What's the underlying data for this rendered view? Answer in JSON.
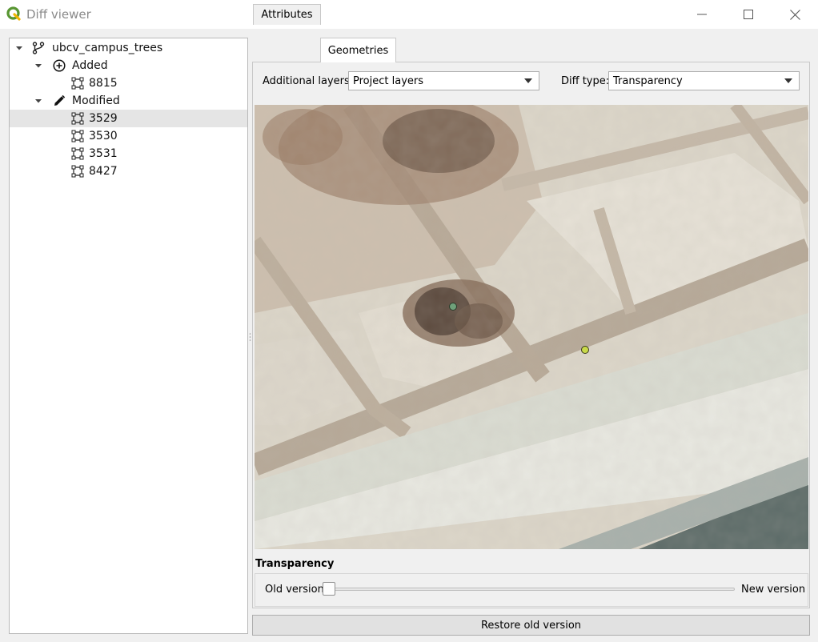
{
  "window": {
    "title": "Diff viewer",
    "app_icon": "qgis-logo-icon",
    "controls": [
      "minimize-icon",
      "maximize-icon",
      "close-icon"
    ]
  },
  "tree": {
    "root": {
      "label": "ubcv_campus_trees",
      "icon": "branch-icon",
      "expanded": true
    },
    "groups": [
      {
        "label": "Added",
        "icon": "plus-circle-icon",
        "expanded": true,
        "items": [
          "8815"
        ]
      },
      {
        "label": "Modified",
        "icon": "pencil-icon",
        "expanded": true,
        "items": [
          "3529",
          "3530",
          "3531",
          "8427"
        ]
      }
    ],
    "selected_item": "3529"
  },
  "tabs": [
    {
      "label": "Attributes",
      "active": false
    },
    {
      "label": "Geometries",
      "active": true
    }
  ],
  "controls": {
    "additional_layers_label": "Additional layers:",
    "additional_layers_value": "Project layers",
    "diff_type_label": "Diff type:",
    "diff_type_value": "Transparency"
  },
  "map": {
    "description_points": [
      {
        "name": "old-point",
        "color": "#6fa07a"
      },
      {
        "name": "new-point",
        "color": "#c8d94a"
      }
    ]
  },
  "transparency": {
    "section_title": "Transparency",
    "old_label": "Old version",
    "new_label": "New version",
    "value": 0
  },
  "restore_button": "Restore old version",
  "colors": {
    "background": "#f0f0f0",
    "selection": "#e5e5e5",
    "qgis_green": "#589632"
  }
}
